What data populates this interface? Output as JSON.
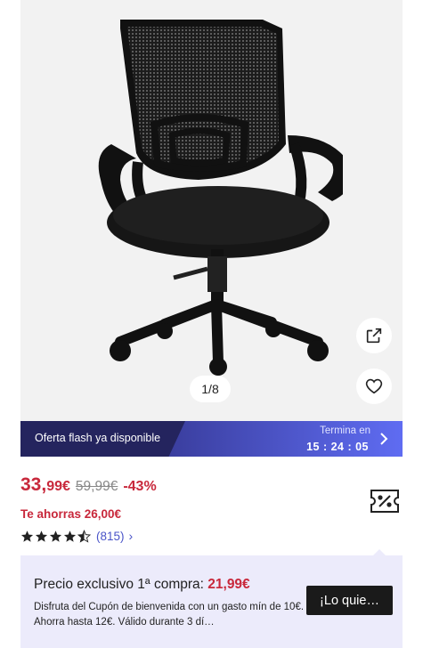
{
  "gallery": {
    "image_alt_icon": "office-chair-image",
    "counter": "1/8",
    "share_icon": "share-external-icon",
    "favorite_icon": "heart-outline-icon"
  },
  "flash": {
    "label": "Oferta flash ya disponible",
    "ends_label": "Termina en",
    "ends_time": "15 : 24 : 05",
    "chevron_icon": "chevron-right-icon"
  },
  "price": {
    "current_int": "33,",
    "current_dec": "99€",
    "old": "59,99€",
    "discount": "-43%",
    "savings": "Te ahorras 26,00€",
    "coupon_icon": "coupon-ticket-icon"
  },
  "rating": {
    "stars": 4.5,
    "reviews": "(815)",
    "chevron": "›"
  },
  "promo": {
    "title_prefix": "Precio exclusivo 1ª compra: ",
    "title_price": "21,99€",
    "description": "Disfruta del Cupón de bienvenida con un gasto mín de 10€. Ahorra hasta 12€. Válido durante 3 dí…",
    "cta": "¡Lo quie…"
  },
  "colors": {
    "accent_red": "#c8283b",
    "link_blue": "#4a54c8",
    "flash_dark": "#24245e",
    "flash_light": "#5f6cf2",
    "promo_bg": "#ecebfb"
  }
}
